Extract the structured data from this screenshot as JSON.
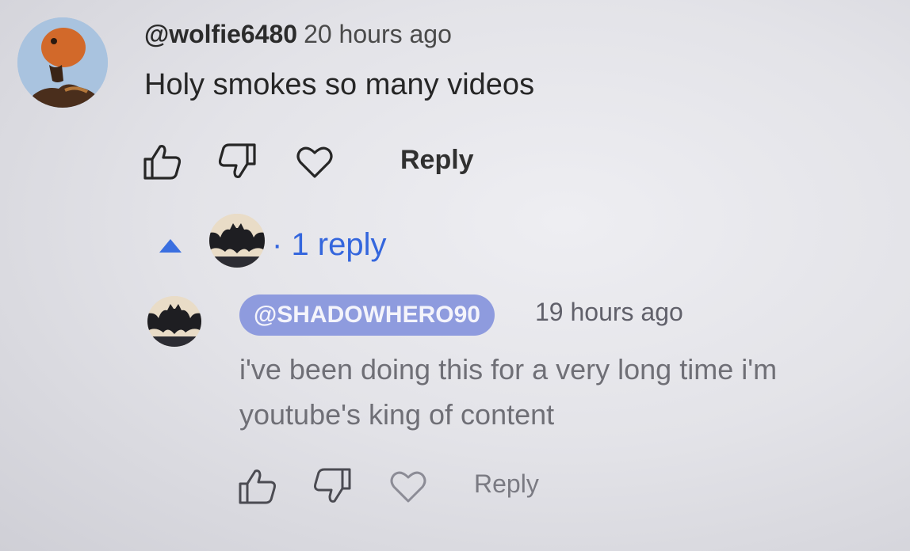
{
  "comment": {
    "username": "@wolfie6480",
    "time": "20 hours ago",
    "text": "Holy smokes so many videos",
    "reply_label": "Reply"
  },
  "replies_toggle": {
    "count_text": "1 reply"
  },
  "reply": {
    "username": "@SHADOWHERO90",
    "time": "19 hours ago",
    "text": "i've been doing this for a very long time i'm youtube's king of content",
    "reply_label": "Reply"
  },
  "colors": {
    "reply_link": "#3466dd",
    "username_chip": "#8e9bde"
  },
  "icons": {
    "like": "thumbs-up-icon",
    "dislike": "thumbs-down-icon",
    "heart": "heart-icon",
    "toggle": "caret-up-icon"
  }
}
